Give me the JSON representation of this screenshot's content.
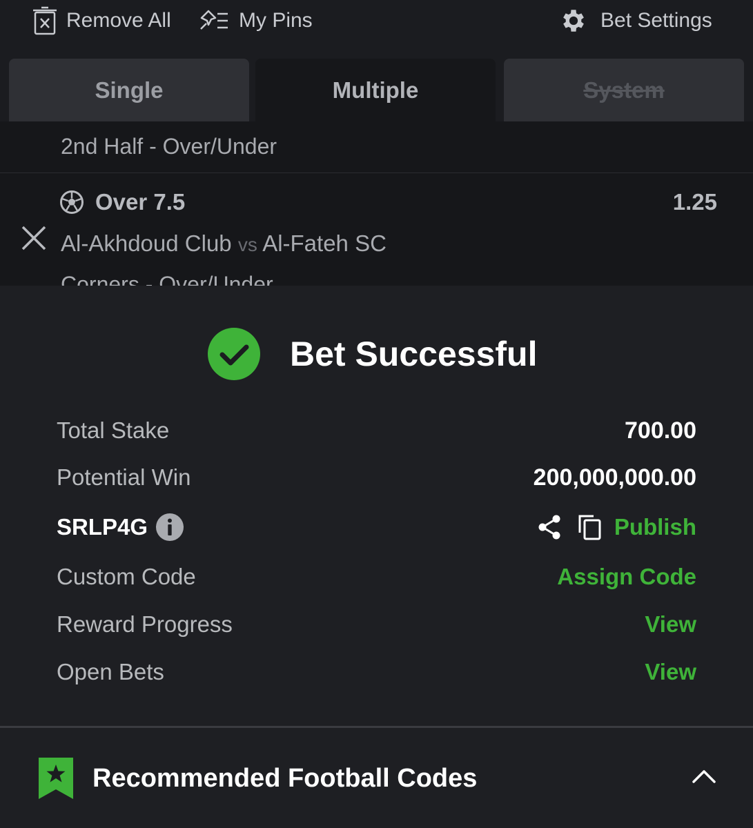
{
  "toolbar": {
    "remove_all": "Remove All",
    "my_pins": "My Pins",
    "bet_settings": "Bet Settings"
  },
  "tabs": [
    {
      "label": "Single"
    },
    {
      "label": "Multiple",
      "active": true
    },
    {
      "label": "System",
      "disabled": true
    }
  ],
  "slip": {
    "prev_market": "2nd Half - Over/Under",
    "selection": "Over 7.5",
    "odds": "1.25",
    "home": "Al-Akhdoud Club",
    "vs": "vs",
    "away": "Al-Fateh SC",
    "market": "Corners - Over/Under"
  },
  "popup": {
    "title": "Bet Successful",
    "total_stake_label": "Total Stake",
    "total_stake": "700.00",
    "potential_win_label": "Potential Win",
    "potential_win": "200,000,000.00",
    "booking_code": "SRLP4G",
    "publish": "Publish",
    "custom_code_label": "Custom Code",
    "assign_code": "Assign Code",
    "reward_progress_label": "Reward Progress",
    "reward_view": "View",
    "open_bets_label": "Open Bets",
    "open_bets_view": "View"
  },
  "recommended": {
    "title": "Recommended Football Codes"
  },
  "colors": {
    "accent_green": "#3fb339",
    "background": "#1b1c20",
    "popup_bg": "#1e1f23"
  }
}
